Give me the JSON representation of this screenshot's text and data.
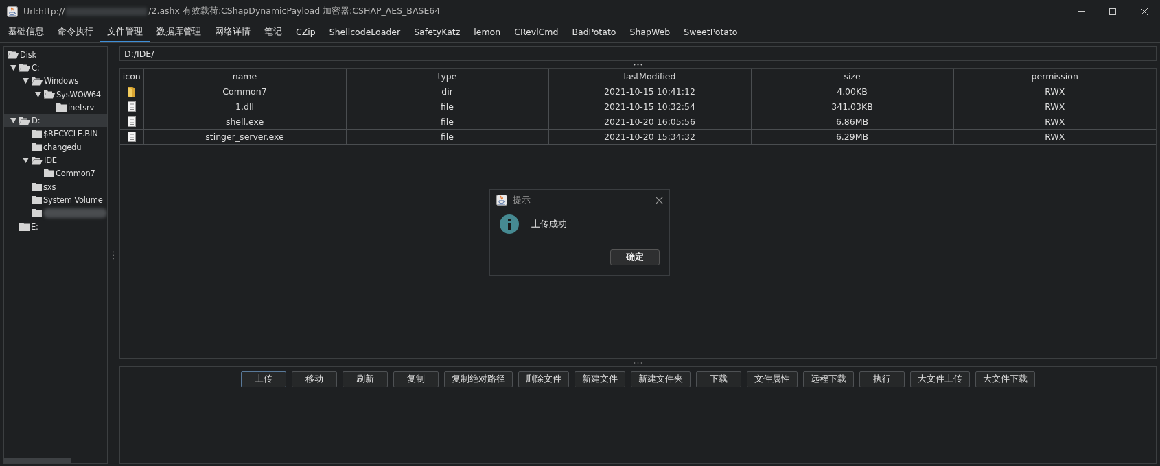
{
  "window": {
    "title_start": "Url:http://",
    "title_end": "/2.ashx 有效载荷:CShapDynamicPayload 加密器:CSHAP_AES_BASE64"
  },
  "tabs": [
    {
      "label": "基础信息",
      "selected": false
    },
    {
      "label": "命令执行",
      "selected": false
    },
    {
      "label": "文件管理",
      "selected": true
    },
    {
      "label": "数据库管理",
      "selected": false
    },
    {
      "label": "网络详情",
      "selected": false
    },
    {
      "label": "笔记",
      "selected": false
    },
    {
      "label": "CZip",
      "selected": false
    },
    {
      "label": "ShellcodeLoader",
      "selected": false
    },
    {
      "label": "SafetyKatz",
      "selected": false
    },
    {
      "label": "lemon",
      "selected": false
    },
    {
      "label": "CRevlCmd",
      "selected": false
    },
    {
      "label": "BadPotato",
      "selected": false
    },
    {
      "label": "ShapWeb",
      "selected": false
    },
    {
      "label": "SweetPotato",
      "selected": false
    }
  ],
  "tree": [
    {
      "label": "Disk",
      "kind": "root",
      "selected": false,
      "expanded": true,
      "children": [
        {
          "label": "C:",
          "kind": "folder",
          "selected": false,
          "expanded": true,
          "children": [
            {
              "label": "Windows",
              "kind": "folder",
              "selected": false,
              "expanded": true,
              "children": [
                {
                  "label": "SysWOW64",
                  "kind": "folder",
                  "selected": false,
                  "expanded": true,
                  "children": [
                    {
                      "label": "inetsrv",
                      "kind": "folder",
                      "selected": false
                    }
                  ]
                }
              ]
            }
          ]
        },
        {
          "label": "D:",
          "kind": "folder",
          "selected": true,
          "expanded": true,
          "children": [
            {
              "label": "$RECYCLE.BIN",
              "kind": "folder",
              "selected": false
            },
            {
              "label": "changedu",
              "kind": "folder",
              "selected": false
            },
            {
              "label": "IDE",
              "kind": "folder",
              "selected": false,
              "expanded": true,
              "children": [
                {
                  "label": "Common7",
                  "kind": "folder",
                  "selected": false
                }
              ]
            },
            {
              "label": "sxs",
              "kind": "folder",
              "selected": false
            },
            {
              "label": "System Volume",
              "kind": "folder",
              "selected": false
            },
            {
              "kind": "redacted",
              "selected": false
            }
          ]
        },
        {
          "label": "E:",
          "kind": "folder",
          "selected": false
        }
      ]
    }
  ],
  "path_field": {
    "value": "D:/IDE/"
  },
  "table": {
    "columns": [
      "icon",
      "name",
      "type",
      "lastModified",
      "size",
      "permission"
    ],
    "rows": [
      {
        "kind": "dir",
        "name": "Common7",
        "type": "dir",
        "lastModified": "2021-10-15 10:41:12",
        "size": "4.00KB",
        "permission": "RWX"
      },
      {
        "kind": "file",
        "name": "1.dll",
        "type": "file",
        "lastModified": "2021-10-15 10:32:54",
        "size": "341.03KB",
        "permission": "RWX"
      },
      {
        "kind": "file",
        "name": "shell.exe",
        "type": "file",
        "lastModified": "2021-10-20 16:05:56",
        "size": "6.86MB",
        "permission": "RWX"
      },
      {
        "kind": "file",
        "name": "stinger_server.exe",
        "type": "file",
        "lastModified": "2021-10-20 15:34:32",
        "size": "6.29MB",
        "permission": "RWX"
      }
    ]
  },
  "dialog": {
    "title": "提示",
    "message": "上传成功",
    "button": "确定"
  },
  "buttons": [
    {
      "label": "上传",
      "focused": true
    },
    {
      "label": "移动",
      "focused": false
    },
    {
      "label": "刷新",
      "focused": false
    },
    {
      "label": "复制",
      "focused": false
    },
    {
      "label": "复制绝对路径",
      "focused": false
    },
    {
      "label": "删除文件",
      "focused": false
    },
    {
      "label": "新建文件",
      "focused": false
    },
    {
      "label": "新建文件夹",
      "focused": false
    },
    {
      "label": "下载",
      "focused": false
    },
    {
      "label": "文件属性",
      "focused": false
    },
    {
      "label": "远程下载",
      "focused": false
    },
    {
      "label": "执行",
      "focused": false
    },
    {
      "label": "大文件上传",
      "focused": false
    },
    {
      "label": "大文件下载",
      "focused": false
    }
  ]
}
